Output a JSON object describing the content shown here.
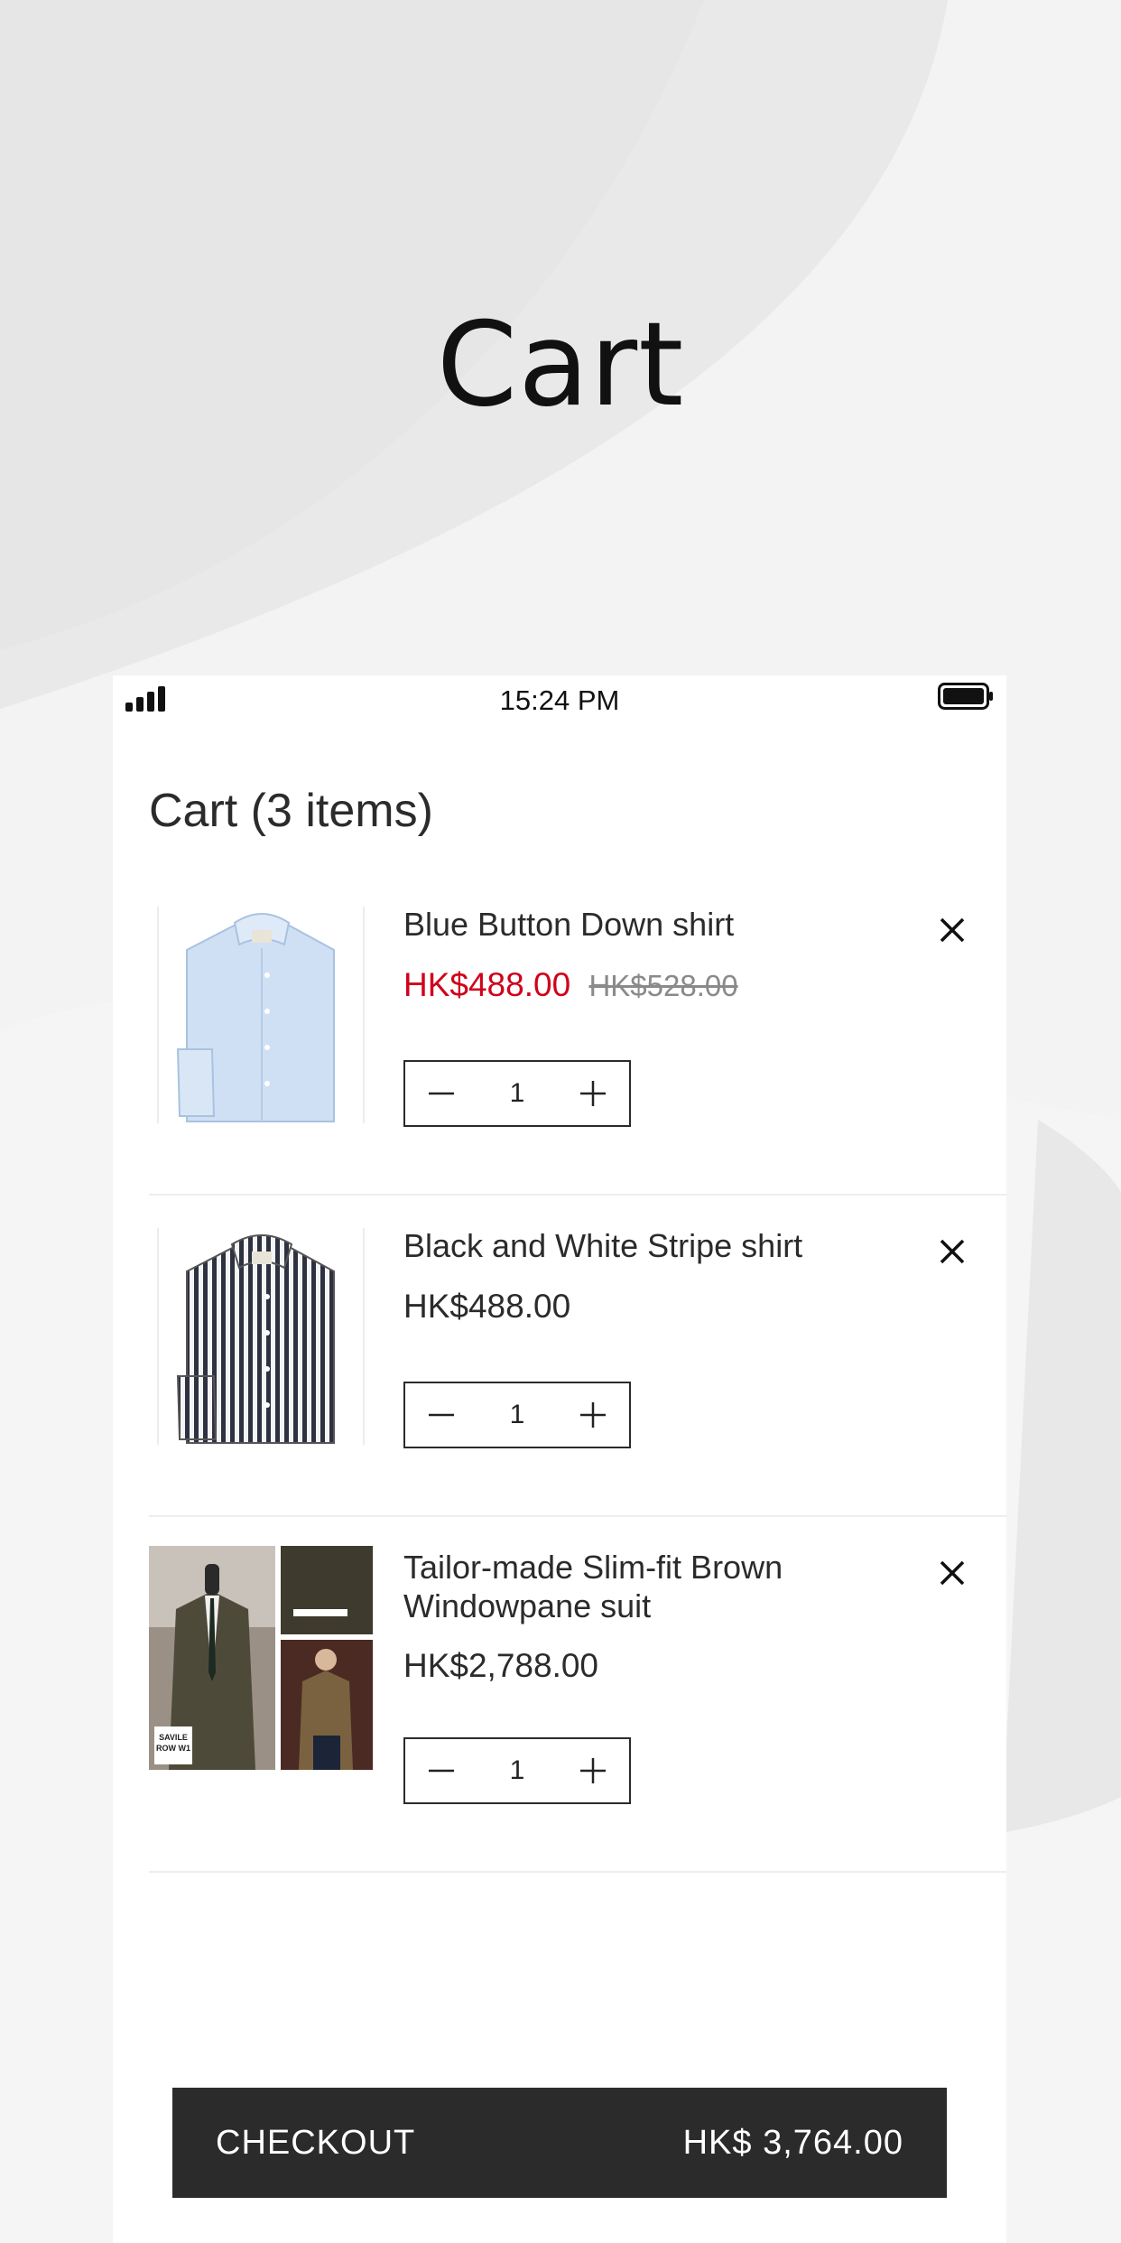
{
  "hero": {
    "title": "Cart"
  },
  "status_bar": {
    "time": "15:24 PM"
  },
  "cart": {
    "heading": "Cart (3 items)",
    "items": [
      {
        "name": "Blue Button Down shirt",
        "price": "HK$488.00",
        "original_price": "HK$528.00",
        "quantity": "1",
        "image": "blue-shirt-image"
      },
      {
        "name": "Black and White Stripe shirt",
        "price": "HK$488.00",
        "quantity": "1",
        "image": "striped-shirt-image"
      },
      {
        "name_line1": "Tailor-made Slim-fit Brown",
        "name_line2": "Windowpane suit",
        "price": "HK$2,788.00",
        "quantity": "1",
        "image": "suit-collage-image",
        "image_text": [
          "SAVILE",
          "ROW W1"
        ]
      }
    ]
  },
  "checkout": {
    "label": "CHECKOUT",
    "total": "HK$ 3,764.00"
  },
  "colors": {
    "sale_price": "#d0021b",
    "text": "#2b2b2b",
    "checkout_bg": "#2b2b2b",
    "old_price": "#8a8a8a"
  }
}
